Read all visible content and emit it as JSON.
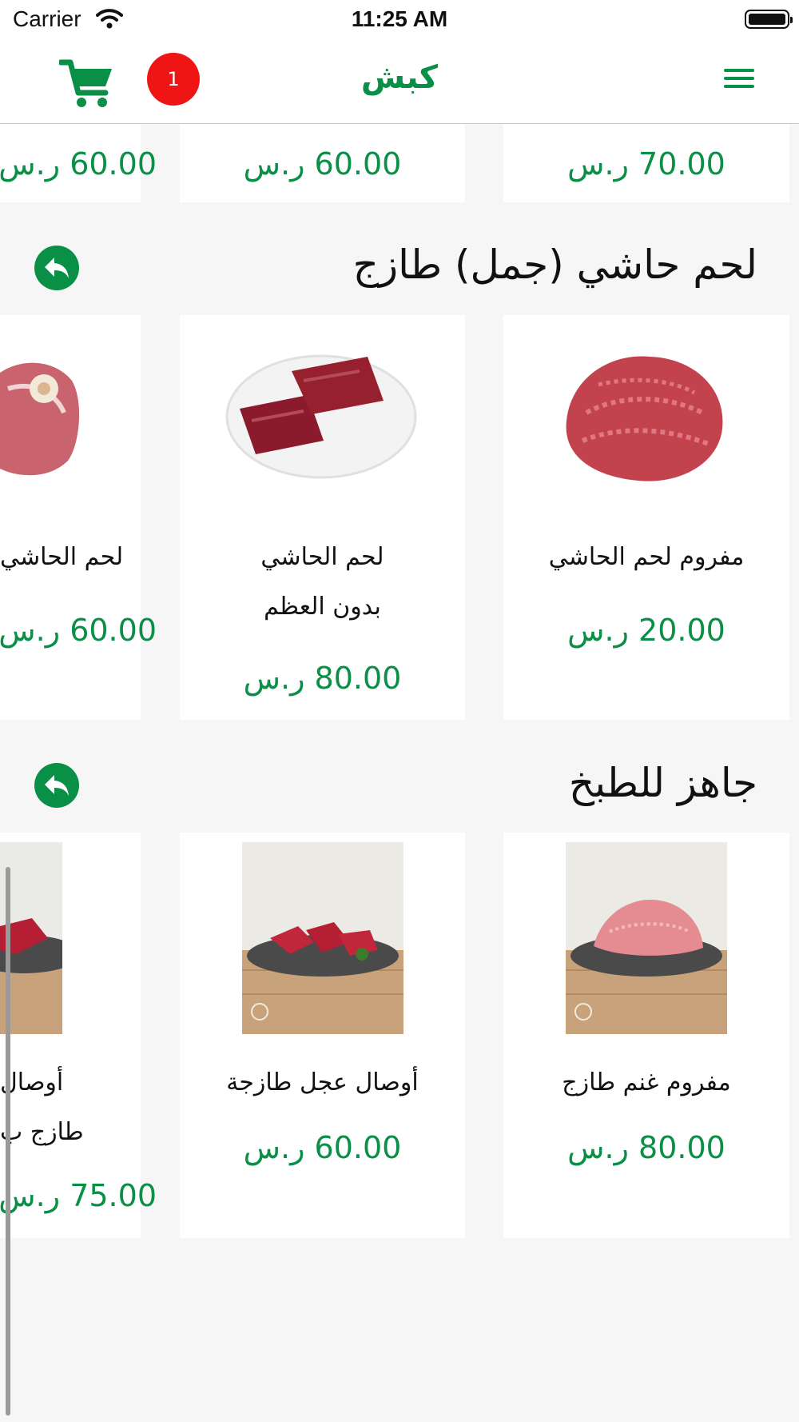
{
  "status_bar": {
    "carrier": "Carrier",
    "time": "11:25 AM"
  },
  "navbar": {
    "title": "كبش",
    "cart_count": "1"
  },
  "top_row": {
    "prices": [
      "60.00 ر.س",
      "60.00 ر.س",
      "70.00 ر.س"
    ]
  },
  "sections": [
    {
      "title": "لحم حاشي (جمل) طازج",
      "products": [
        {
          "name": "لحم الحاشي",
          "price": "60.00 ر.س"
        },
        {
          "name": "لحم الحاشي\nبدون العظم",
          "price": "80.00 ر.س"
        },
        {
          "name": "مفروم لحم الحاشي",
          "price": "20.00 ر.س"
        }
      ]
    },
    {
      "title": "جاهز للطبخ",
      "products": [
        {
          "name": "أوصال\nطازج ب",
          "price": "75.00 ر.س"
        },
        {
          "name": "أوصال عجل طازجة",
          "price": "60.00 ر.س"
        },
        {
          "name": "مفروم غنم طازج",
          "price": "80.00 ر.س"
        }
      ]
    }
  ],
  "colors": {
    "accent": "#0a8f47",
    "badge": "#f01515",
    "background": "#f6f6f6"
  },
  "icons": [
    "wifi-icon",
    "battery-icon",
    "menu-icon",
    "cart-icon",
    "share-icon"
  ]
}
